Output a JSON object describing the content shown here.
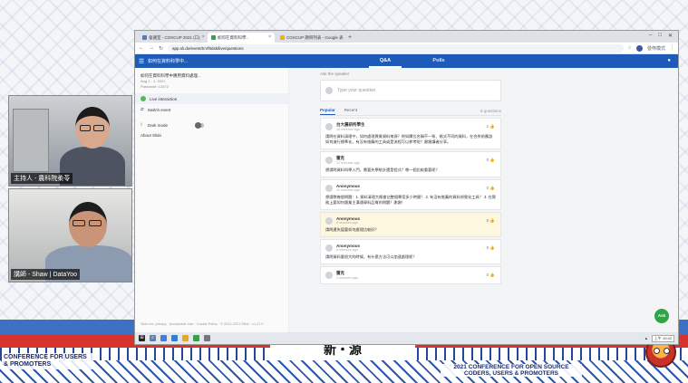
{
  "backdrop": {
    "caption": "新・源",
    "left_banner": "CONFERENCE FOR USERS & PROMOTERS",
    "right_banner": "2021 CONFERENCE FOR OPEN SOURCE CODERS, USERS & PROMOTERS",
    "colors": {
      "red": "#d6332d",
      "blue": "#3d71c4",
      "navy": "#24479a"
    }
  },
  "cams": {
    "host_label": "主持人 - 農科院柔苓",
    "guest_label": "講師 - Shaw | DataYoo"
  },
  "browser": {
    "tabs": [
      {
        "label": "會議室 - COSCUP 2021 (口)",
        "icon": "meeting-icon"
      },
      {
        "label": "如何在資料科學..",
        "icon": "slido-icon"
      },
      {
        "label": "COSCUP 題目列表 - Google 表",
        "icon": "sheets-icon"
      }
    ],
    "url": "app.sli.do/event/tcVf8dsk/live/questions",
    "profile": "發佈模式"
  },
  "app": {
    "event_title": "如何在資料科學中...",
    "nav_qa": "Q&A",
    "nav_polls": "Polls",
    "sidebar": {
      "title": "如何在資料科學中應用資料處理...",
      "date": "Aug 1 - 1, 2021",
      "code": "Passcode: 12#72",
      "live_interaction": "Live interaction",
      "switch_event": "Switch event",
      "dark_mode": "Dark mode",
      "about": "About Slido",
      "footer": "Slido Inc. privacy · Acceptable Use · Cookie Policy · © 2012-2021 Slido · v1.47.0"
    },
    "ask": {
      "label": "Ask the speaker",
      "placeholder": "Type your question"
    },
    "sort": {
      "popular": "Popular",
      "recent": "Recent",
      "count": "6 questions"
    },
    "questions": [
      {
        "author": "台大農研所學生",
        "time": "15 minutes ago",
        "likes": "1",
        "text": "請問在資料清理中，如何處理異質資料來源？例如欄位名稱不一致、格式不同的資料，在合併前應該如何進行標準化，有沒有推薦的工具或是流程可以參考呢？謝謝講者分享。"
      },
      {
        "author": "雷克",
        "time": "12 minutes ago",
        "likes": "0",
        "text": "想請問資料科學入門，需要先學統計還是程式？哪一個比較重要呢？"
      },
      {
        "author": "Anonymous",
        "time": "10 minutes ago",
        "likes": "0",
        "text": "想請教幾個問題：1. 資料清理大概會佔整個專案多少時間？ 2. 有沒有推薦的資料視覺化工具？ 3. 在實務上要如何跟業主溝通資料品質的問題？謝謝！"
      },
      {
        "author": "Anonymous",
        "time": "8 minutes ago",
        "likes": "0",
        "text": "請問遺失值要如何處理比較好？",
        "highlight": true
      },
      {
        "author": "Anonymous",
        "time": "6 minutes ago",
        "likes": "0",
        "text": "請問資料量很大的時候，有什麼方法可以加速處理呢？"
      },
      {
        "author": "雷克",
        "time": "2 minutes ago",
        "likes": "0",
        "text": ""
      }
    ],
    "ask_fab": "Ask"
  },
  "taskbar": {
    "clock": "上午 10:42"
  }
}
